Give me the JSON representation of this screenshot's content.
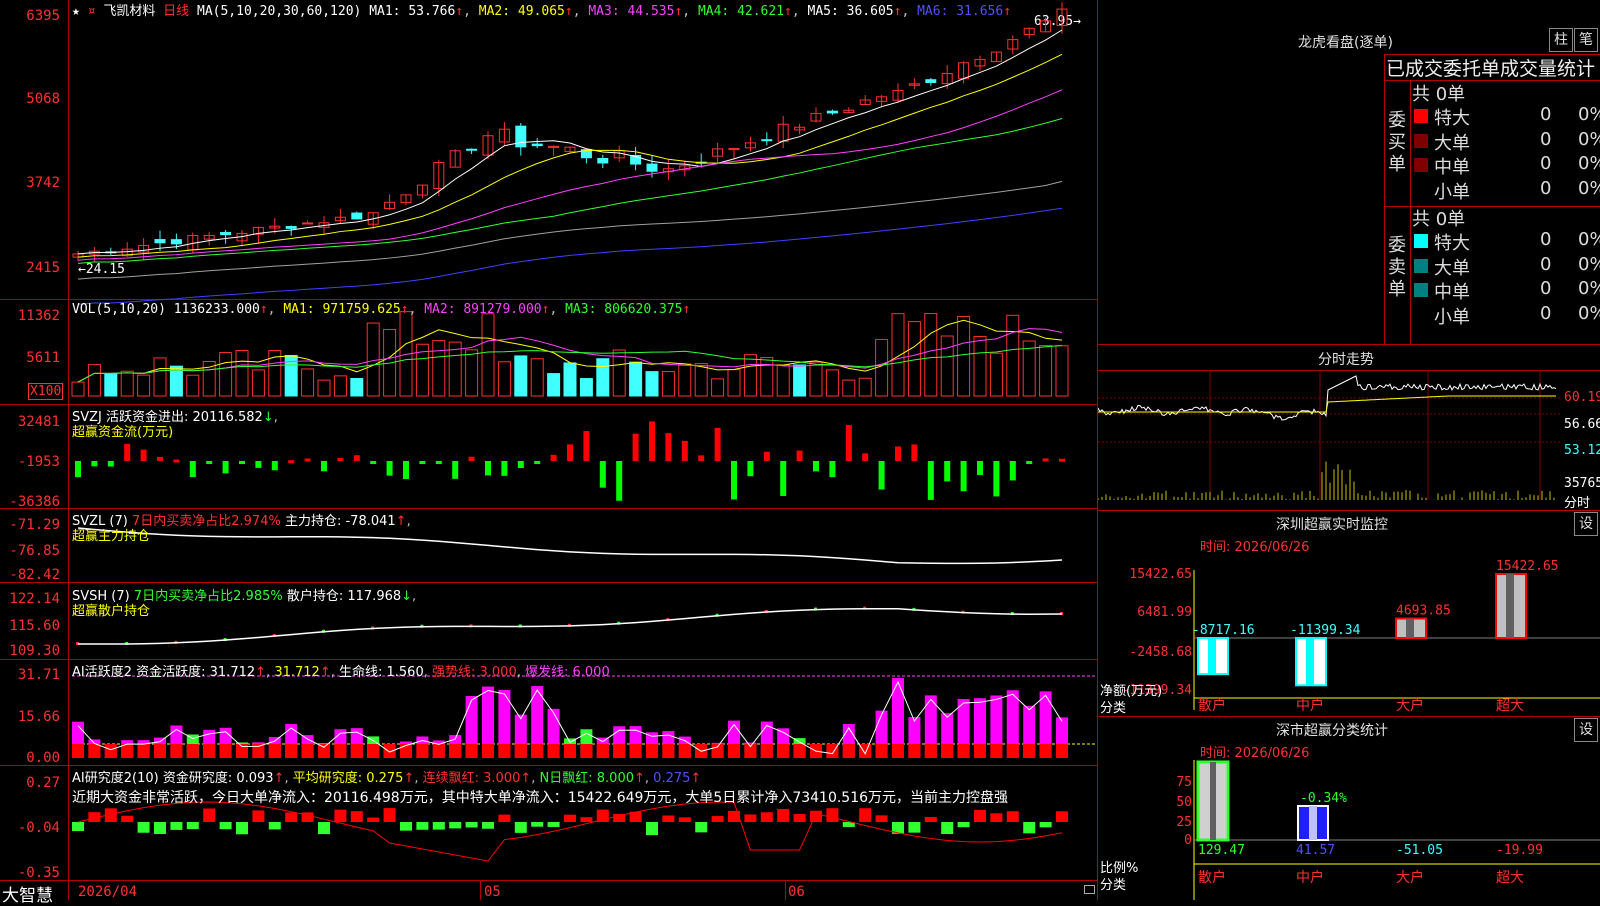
{
  "header": {
    "stock_name": "飞凯材料",
    "period": "日线",
    "ma_prefix": "MA(5,10,20,30,60,120)",
    "ma1": "MA1: 53.766",
    "ma2": "MA2: 49.065",
    "ma3": "MA3: 44.535",
    "ma4": "MA4: 42.621",
    "ma5": "MA5: 36.605",
    "ma6": "MA6: 31.656",
    "high_mark": "63.95",
    "low_mark": "24.15"
  },
  "price_axis": [
    "6395",
    "5068",
    "3742",
    "2415"
  ],
  "vol": {
    "title": "VOL(5,10,20)",
    "value": "1136233.000",
    "ma1": "MA1: 971759.625",
    "ma2": "MA2: 891279.000",
    "ma3": "MA3: 806620.375",
    "axis": [
      "11362",
      "5611"
    ],
    "unit": "X100"
  },
  "svzj": {
    "title": "SVZJ  活跃资金进出: 20116.582",
    "subtitle": "超赢资金流(万元)",
    "axis": [
      "32481",
      "-1953",
      "-36386"
    ]
  },
  "svzl": {
    "title": "SVZL (7)",
    "pct": "7日内买卖净占比2.974%",
    "hold": "主力持仓: -78.041",
    "subtitle": "超赢主力持仓",
    "axis": [
      "-71.29",
      "-76.85",
      "-82.42"
    ]
  },
  "svsh": {
    "title": "SVSH (7)",
    "pct": "7日内买卖净占比2.985%",
    "hold": "散户持仓: 117.968",
    "subtitle": "超赢散户持仓",
    "axis": [
      "122.14",
      "115.60",
      "109.30"
    ]
  },
  "ai2": {
    "title": "AI活跃度2 资金活跃度: 31.712",
    "v2": "31.712",
    "life": "生命线: 1.560",
    "strong": "强势线: 3.000",
    "burst": "爆发线: 6.000",
    "axis": [
      "31.71",
      "15.66",
      "0.00"
    ]
  },
  "ai_research": {
    "title": "AI研究度2(10) 资金研究度: 0.093",
    "avg": "平均研究度: 0.275",
    "cont": "连续飘红: 3.000",
    "ndays": "N日飘红: 8.000",
    "last": "0.275",
    "summary": "近期大资金非常活跃，今日大单净流入：20116.498万元，其中特大单净流入：15422.649万元，大单5日累计净入73410.516万元，当前主力控盘强",
    "axis": [
      "0.27",
      "-0.04",
      "-0.35"
    ]
  },
  "date_axis": {
    "brand": "大智慧",
    "start": "2026/04",
    "m5": "05",
    "m6": "06"
  },
  "dragon": {
    "title": "龙虎看盘(逐单)",
    "btn_bar": "柱",
    "btn_pen": "笔",
    "tab": "已成交委托单成交量统计",
    "buy_label": "委买单",
    "sell_label": "委卖单",
    "buy_total": "共 0单",
    "sell_total": "共 0单",
    "buy_rows": [
      {
        "name": "特大",
        "count": "0",
        "pct": "0%",
        "color": "#ff0000"
      },
      {
        "name": "大单",
        "count": "0",
        "pct": "0%",
        "color": "#800000"
      },
      {
        "name": "中单",
        "count": "0",
        "pct": "0%",
        "color": "#800000"
      },
      {
        "name": "小单",
        "count": "0",
        "pct": "0%",
        "color": ""
      }
    ],
    "sell_rows": [
      {
        "name": "特大",
        "count": "0",
        "pct": "0%",
        "color": "#00ffff"
      },
      {
        "name": "大单",
        "count": "0",
        "pct": "0%",
        "color": "#008080"
      },
      {
        "name": "中单",
        "count": "0",
        "pct": "0%",
        "color": "#008080"
      },
      {
        "name": "小单",
        "count": "0",
        "pct": "0%",
        "color": ""
      }
    ]
  },
  "intraday": {
    "title": "分时走势",
    "axis": [
      "60.19",
      "56.66",
      "53.12"
    ],
    "vol_max": "35765",
    "vol_unit": "分时"
  },
  "sz_monitor": {
    "title": "深圳超赢实时监控",
    "set": "设",
    "time": "时间: 2026/06/26",
    "yaxis": [
      "15422.65",
      "6481.99",
      "-2458.68",
      "-11399.34"
    ],
    "net_label": "净额(万元)",
    "cat_label": "分类",
    "bars": [
      {
        "name": "散户",
        "value": "-8717.16"
      },
      {
        "name": "中户",
        "value": "-11399.34"
      },
      {
        "name": "大户",
        "value": "4693.85"
      },
      {
        "name": "超大",
        "value": "15422.65"
      }
    ]
  },
  "sz_class": {
    "title": "深市超赢分类统计",
    "set": "设",
    "time": "时间: 2026/06/26",
    "yaxis": [
      "75",
      "50",
      "25",
      "0"
    ],
    "ratio_label": "比例%",
    "cat_label": "分类",
    "mid_label": "-0.34%",
    "bars": [
      {
        "name": "散户",
        "value": "129.47"
      },
      {
        "name": "中户",
        "value": "41.57"
      },
      {
        "name": "大户",
        "value": "-51.05"
      },
      {
        "name": "超大",
        "value": "-19.99"
      }
    ]
  },
  "colors": {
    "up": "#ff3030",
    "down": "#40ffff",
    "grid": "#b00000",
    "ma1": "#ffffff",
    "ma2": "#ffff00",
    "ma3": "#ff40ff",
    "ma4": "#30ff30",
    "ma5": "#a0a0a0",
    "ma6": "#4040ff"
  }
}
